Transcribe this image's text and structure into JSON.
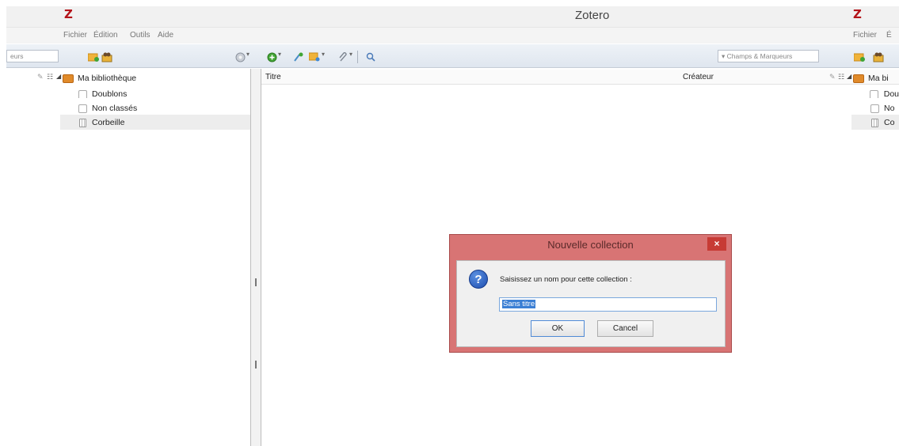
{
  "window": {
    "title": "Zotero",
    "logo": "Z"
  },
  "menu": {
    "items": [
      "Fichier",
      "Édition",
      "Outils",
      "Aide"
    ],
    "right_items": [
      "Fichier",
      "É"
    ]
  },
  "toolbar": {
    "left_search_partial": "eurs",
    "search_placeholder": "Champs & Marqueurs"
  },
  "collections": [
    {
      "label": "Ma bibliothèque",
      "icon": "library-icon"
    },
    {
      "label": "Doublons",
      "icon": "duplicates-icon"
    },
    {
      "label": "Non classés",
      "icon": "unfiled-icon"
    },
    {
      "label": "Corbeille",
      "icon": "trash-icon"
    }
  ],
  "right_collections": [
    "Ma bi",
    "Dou",
    "No",
    "Co"
  ],
  "columns": {
    "title": "Titre",
    "creator": "Créateur"
  },
  "dialog": {
    "title": "Nouvelle collection",
    "close": "×",
    "prompt": "Saisissez un nom pour cette collection :",
    "input_value": "Sans titre",
    "ok": "OK",
    "cancel": "Cancel",
    "question_glyph": "?"
  },
  "colors": {
    "brand": "#b4141a",
    "dialog_frame": "#d87474",
    "close_button": "#c73b35",
    "selection": "#3b7fd4"
  }
}
